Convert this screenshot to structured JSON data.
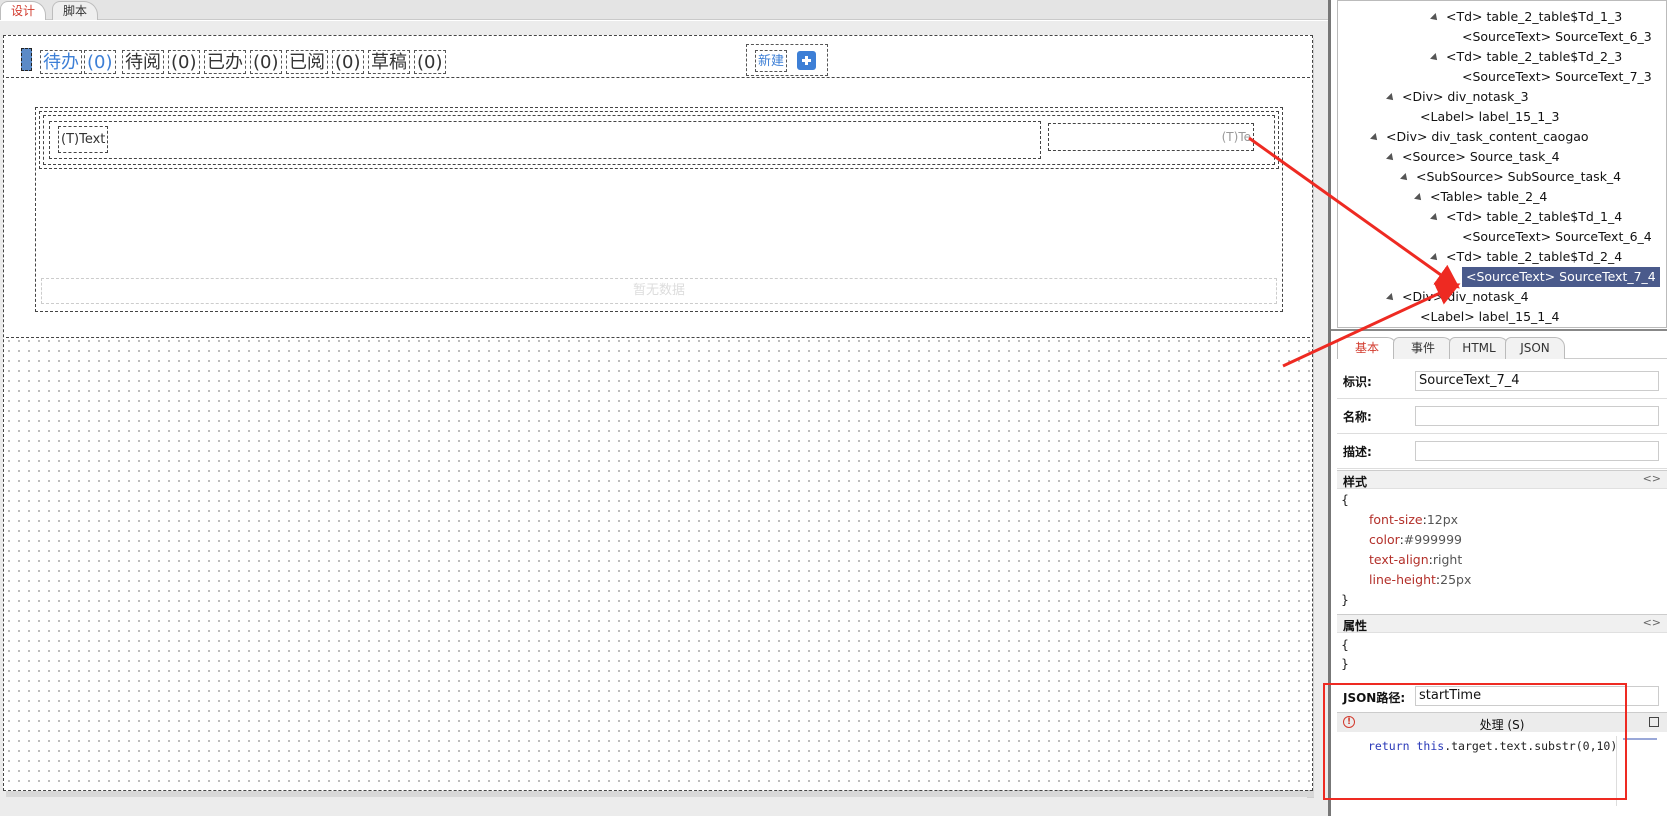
{
  "top_tabs": [
    {
      "label": "设计",
      "active": true
    },
    {
      "label": "脚本",
      "active": false
    }
  ],
  "task_tabs": [
    {
      "label": "待办",
      "count": "(0)",
      "active": true
    },
    {
      "label": "待阅",
      "count": "(0)",
      "active": false
    },
    {
      "label": "已办",
      "count": "(0)",
      "active": false
    },
    {
      "label": "已阅",
      "count": "(0)",
      "active": false
    },
    {
      "label": "草稿",
      "count": "(0)",
      "active": false
    }
  ],
  "new_button": {
    "label": "新建",
    "icon": "plus-square-icon"
  },
  "row_cell_1_text": "(T)Text",
  "row_cell_2_text": "(T)Te",
  "no_data_text": "暂无数据",
  "tree": [
    {
      "text": "<Td> table_2_table$Td_1_3",
      "indent": 108,
      "arrow": true
    },
    {
      "text": "<SourceText> SourceText_6_3",
      "indent": 124,
      "arrow": false
    },
    {
      "text": "<Td> table_2_table$Td_2_3",
      "indent": 108,
      "arrow": true
    },
    {
      "text": "<SourceText> SourceText_7_3",
      "indent": 124,
      "arrow": false
    },
    {
      "text": "<Div> div_notask_3",
      "indent": 64,
      "arrow": true
    },
    {
      "text": "<Label> label_15_1_3",
      "indent": 82,
      "arrow": false
    },
    {
      "text": "<Div> div_task_content_caogao",
      "indent": 48,
      "arrow": true
    },
    {
      "text": "<Source> Source_task_4",
      "indent": 64,
      "arrow": true
    },
    {
      "text": "<SubSource> SubSource_task_4",
      "indent": 78,
      "arrow": true
    },
    {
      "text": "<Table> table_2_4",
      "indent": 92,
      "arrow": true
    },
    {
      "text": "<Td> table_2_table$Td_1_4",
      "indent": 108,
      "arrow": true
    },
    {
      "text": "<SourceText> SourceText_6_4",
      "indent": 124,
      "arrow": false
    },
    {
      "text": "<Td> table_2_table$Td_2_4",
      "indent": 108,
      "arrow": true
    },
    {
      "text": "<SourceText> SourceText_7_4",
      "indent": 124,
      "arrow": false,
      "selected": true
    },
    {
      "text": "<Div> div_notask_4",
      "indent": 64,
      "arrow": true
    },
    {
      "text": "<Label> label_15_1_4",
      "indent": 82,
      "arrow": false
    }
  ],
  "prop_tabs": [
    {
      "label": "基本",
      "active": true
    },
    {
      "label": "事件",
      "active": false
    },
    {
      "label": "HTML",
      "active": false
    },
    {
      "label": "JSON",
      "active": false
    }
  ],
  "fields": {
    "id_label": "标识:",
    "id_value": "SourceText_7_4",
    "name_label": "名称:",
    "name_value": "",
    "desc_label": "描述:",
    "desc_value": ""
  },
  "style_section": {
    "title": "样式",
    "toggle": "<>",
    "open": "{",
    "close": "}",
    "props": [
      {
        "key": "font-size",
        "value": "12px"
      },
      {
        "key": "color",
        "value": "#999999"
      },
      {
        "key": "text-align",
        "value": "right"
      },
      {
        "key": "line-height",
        "value": "25px"
      }
    ]
  },
  "attr_section": {
    "title": "属性",
    "toggle": "<>",
    "open": "{",
    "close": "}"
  },
  "json_path": {
    "label": "JSON路径:",
    "value": "startTime"
  },
  "process": {
    "title": "处理 (S)",
    "warn_icon": "!",
    "code_kw1": "return",
    "code_kw2": "this",
    "code_rest": ".target.text.substr(0,10)"
  },
  "colors": {
    "accent": "#3d7fd6",
    "highlight": "#ee2a22",
    "selected_row": "#4a5a8b"
  }
}
